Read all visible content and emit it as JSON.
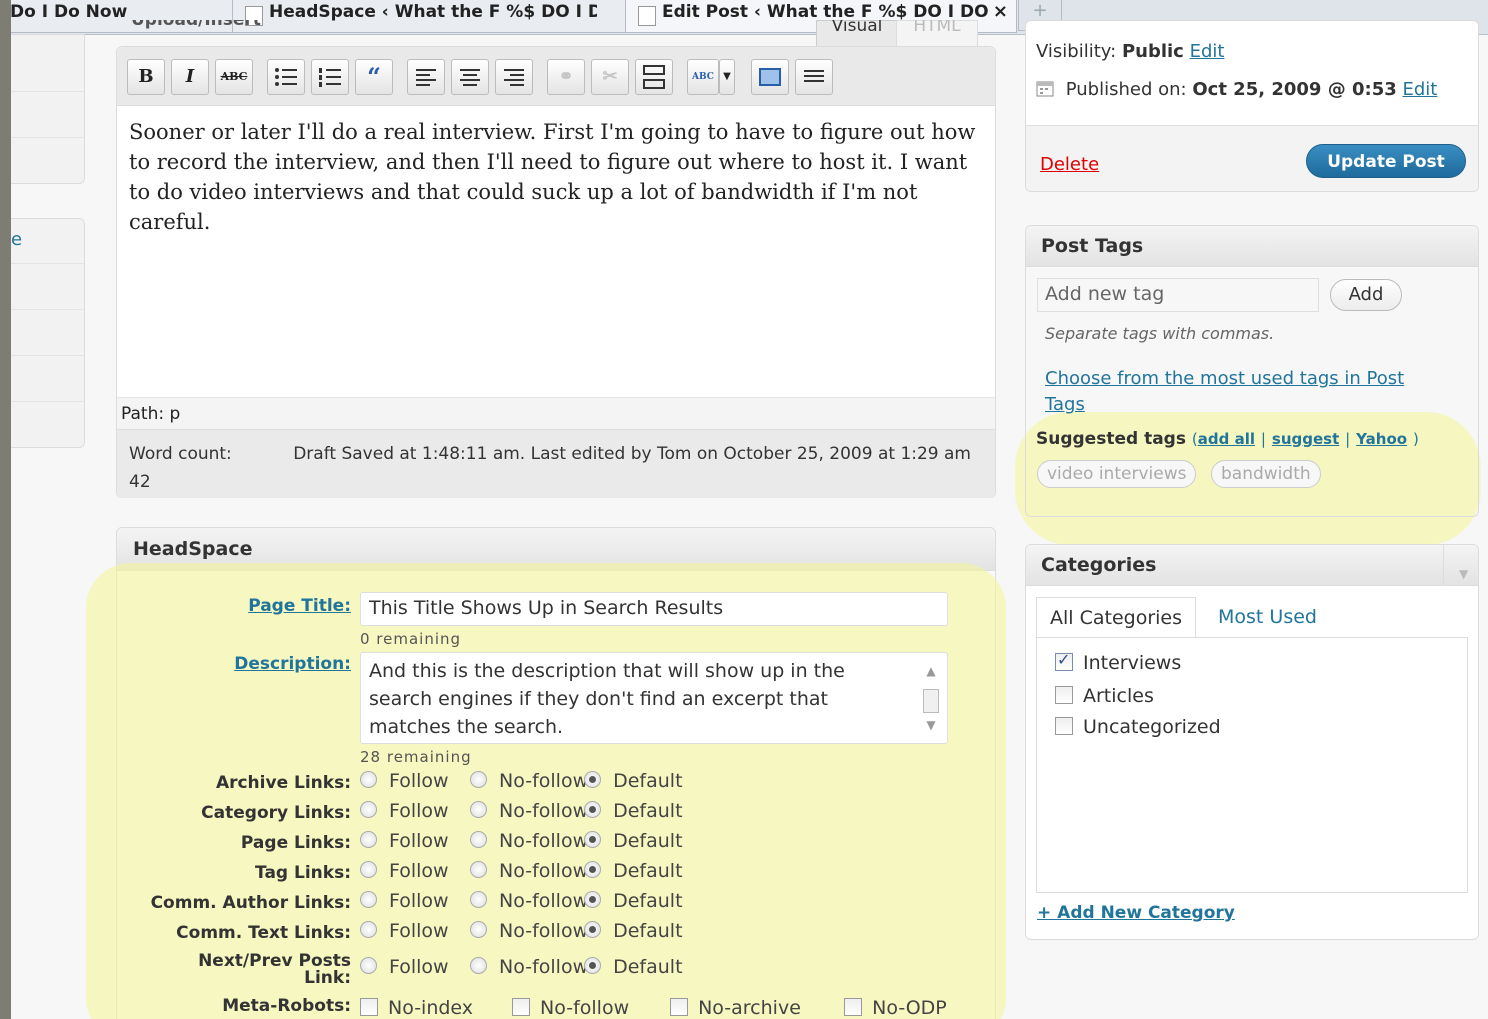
{
  "browser": {
    "tabs": [
      {
        "label": "Do I Do Now"
      },
      {
        "label": "HeadSpace ‹ What the F %$ DO I DO N..."
      },
      {
        "label": "Edit Post ‹ What the F %$ DO I DO...",
        "close": "×"
      }
    ],
    "new_tab": "+"
  },
  "sidebar_left": {
    "partial_link": "e"
  },
  "editor": {
    "upload_label": "Upload/Insert",
    "visual_tab": "Visual",
    "html_tab": "HTML",
    "toolbar": {
      "bold": "B",
      "italic": "I",
      "strike": "ABC",
      "spell": "ABC"
    },
    "content": "Sooner or later I'll do a real interview. First I'm going to have to figure out how to record the interview, and then I'll need to figure out where to host it. I want to do video interviews and that could suck up a lot of bandwidth if I'm not careful.",
    "path": "Path: p",
    "word_count_label": "Word count:",
    "word_count": "42",
    "draft_status": "Draft Saved at 1:48:11 am. Last edited by Tom on October 25, 2009 at 1:29 am"
  },
  "headspace": {
    "title": "HeadSpace",
    "page_title_label": "Page Title:",
    "page_title_value": "This Title Shows Up in Search Results",
    "page_title_remaining": "0 remaining",
    "description_label": "Description:",
    "description_value": "And this is the description that will show up in the search engines if they don't find an excerpt that matches the search.",
    "description_remaining": "28 remaining",
    "option_labels": {
      "follow": "Follow",
      "nofollow": "No-follow",
      "default": "Default"
    },
    "link_rows": [
      {
        "label": "Archive Links:",
        "selected": "default"
      },
      {
        "label": "Category Links:",
        "selected": "default"
      },
      {
        "label": "Page Links:",
        "selected": "default"
      },
      {
        "label": "Tag Links:",
        "selected": "default"
      },
      {
        "label": "Comm. Author Links:",
        "selected": "default"
      },
      {
        "label": "Comm. Text Links:",
        "selected": "default"
      },
      {
        "label_line1": "Next/Prev Posts",
        "label_line2": "Link:",
        "selected": "default"
      }
    ],
    "meta_robots_label": "Meta-Robots:",
    "meta_robots": [
      "No-index",
      "No-follow",
      "No-archive",
      "No-ODP"
    ]
  },
  "publish": {
    "visibility_label": "Visibility:",
    "visibility_value": "Public",
    "edit": "Edit",
    "published_label": "Published on:",
    "published_value": "Oct 25, 2009 @ 0:53",
    "delete": "Delete",
    "update": "Update Post"
  },
  "post_tags": {
    "title": "Post Tags",
    "placeholder": "Add new tag",
    "add": "Add",
    "hint": "Separate tags with commas.",
    "choose_link": "Choose from the most used tags in Post Tags",
    "suggested_label": "Suggested tags",
    "links": [
      "add all",
      "suggest",
      "Yahoo"
    ],
    "suggested": [
      "video interviews",
      "bandwidth"
    ]
  },
  "categories": {
    "title": "Categories",
    "tabs": [
      "All Categories",
      "Most Used"
    ],
    "items": [
      {
        "label": "Interviews",
        "checked": true
      },
      {
        "label": "Articles",
        "checked": false
      },
      {
        "label": "Uncategorized",
        "checked": false
      }
    ],
    "add_new": "+ Add New Category"
  }
}
